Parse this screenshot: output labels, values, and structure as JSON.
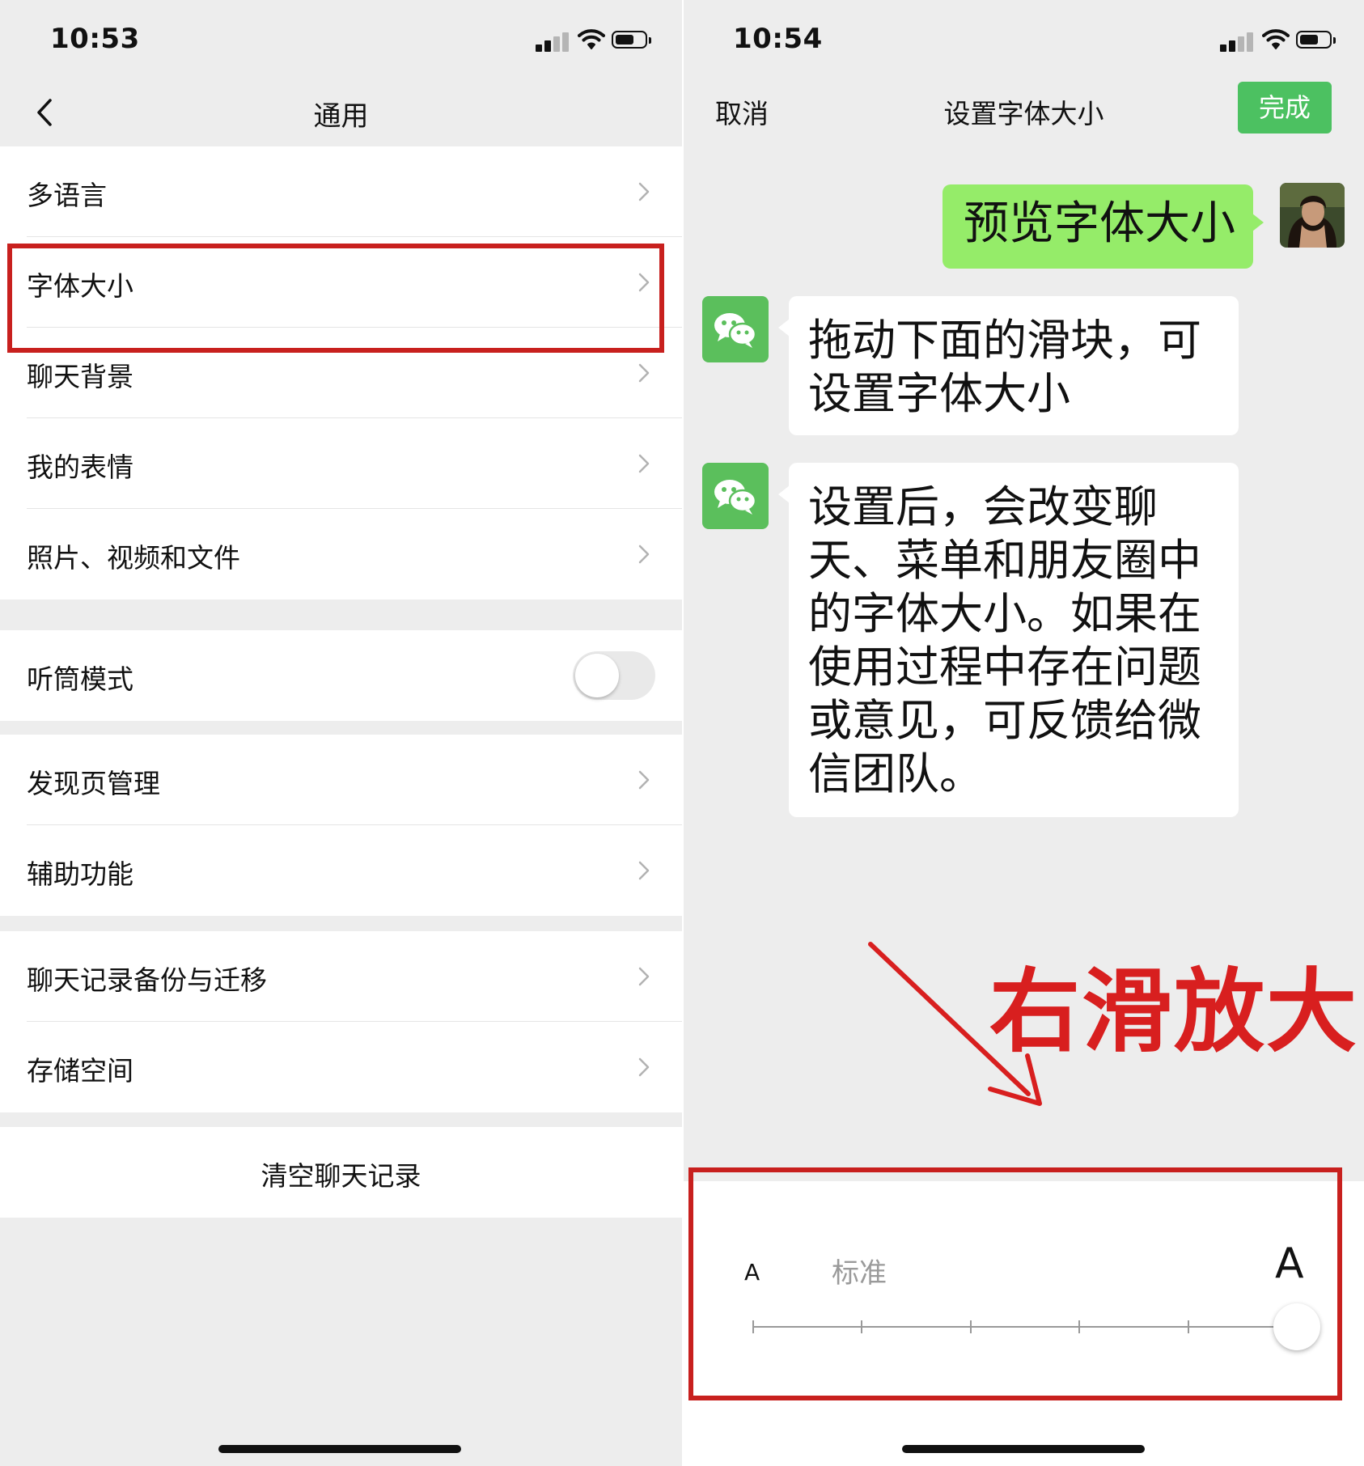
{
  "left_screen": {
    "status_time": "10:53",
    "nav_title": "通用",
    "groups": [
      [
        "多语言",
        "字体大小",
        "聊天背景",
        "我的表情",
        "照片、视频和文件"
      ],
      [
        "听筒模式"
      ],
      [
        "发现页管理",
        "辅助功能"
      ],
      [
        "聊天记录备份与迁移",
        "存储空间"
      ],
      [
        "清空聊天记录"
      ]
    ],
    "earpiece_mode_on": false,
    "highlighted_item": "字体大小"
  },
  "right_screen": {
    "status_time": "10:54",
    "cancel_label": "取消",
    "title": "设置字体大小",
    "done_label": "完成",
    "preview_message": "预览字体大小",
    "messages": [
      "拖动下面的滑块，可设置字体大小",
      "设置后，会改变聊天、菜单和朋友圈中的字体大小。如果在使用过程中存在问题或意见，可反馈给微信团队。"
    ],
    "annotation": "右滑放大",
    "slider": {
      "small_label": "A",
      "standard_label": "标准",
      "large_label": "A",
      "steps": 6,
      "current_step": 6
    }
  },
  "colors": {
    "highlight_red": "#c8201e",
    "annotation_red": "#d81f1f",
    "wechat_green": "#4cc161",
    "bubble_green": "#95ec69",
    "background": "#ededed"
  }
}
